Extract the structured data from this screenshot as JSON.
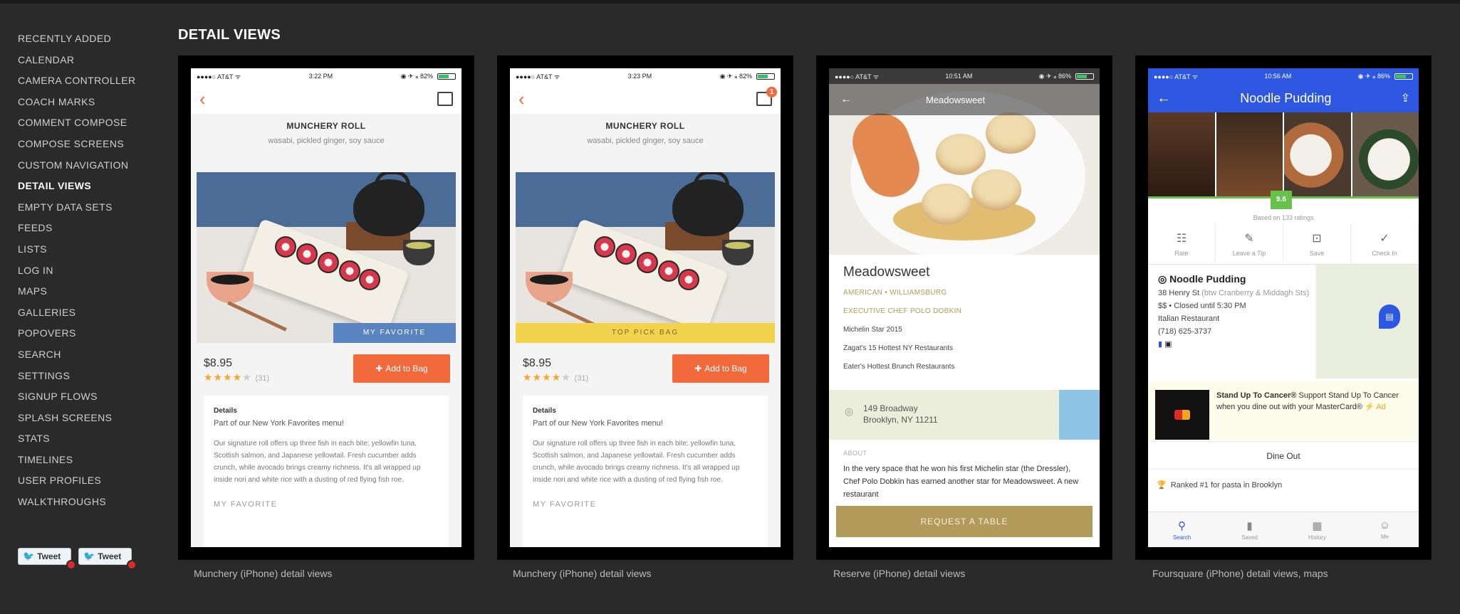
{
  "sidebar": {
    "items": [
      {
        "label": "RECENTLY ADDED",
        "active": false
      },
      {
        "label": "CALENDAR",
        "active": false
      },
      {
        "label": "CAMERA CONTROLLER",
        "active": false
      },
      {
        "label": "COACH MARKS",
        "active": false
      },
      {
        "label": "COMMENT COMPOSE",
        "active": false
      },
      {
        "label": "COMPOSE SCREENS",
        "active": false
      },
      {
        "label": "CUSTOM NAVIGATION",
        "active": false
      },
      {
        "label": "DETAIL VIEWS",
        "active": true
      },
      {
        "label": "EMPTY DATA SETS",
        "active": false
      },
      {
        "label": "FEEDS",
        "active": false
      },
      {
        "label": "LISTS",
        "active": false
      },
      {
        "label": "LOG IN",
        "active": false
      },
      {
        "label": "MAPS",
        "active": false
      },
      {
        "label": "GALLERIES",
        "active": false
      },
      {
        "label": "POPOVERS",
        "active": false
      },
      {
        "label": "SEARCH",
        "active": false
      },
      {
        "label": "SETTINGS",
        "active": false
      },
      {
        "label": "SIGNUP FLOWS",
        "active": false
      },
      {
        "label": "SPLASH SCREENS",
        "active": false
      },
      {
        "label": "STATS",
        "active": false
      },
      {
        "label": "TIMELINES",
        "active": false
      },
      {
        "label": "USER PROFILES",
        "active": false
      },
      {
        "label": "WALKTHROUGHS",
        "active": false
      }
    ],
    "tweet_buttons": [
      "Tweet",
      "Tweet"
    ]
  },
  "section_title": "DETAIL VIEWS",
  "captions": [
    "Munchery (iPhone) detail views",
    "Munchery (iPhone) detail views",
    "Reserve (iPhone) detail views",
    "Foursquare (iPhone) detail views, maps"
  ],
  "munchery1": {
    "status_left": "●●●●○ AT&T ᯤ",
    "status_time": "3:22 PM",
    "status_right": "◉ ✈ ⁎ 82%",
    "dish_title": "MUNCHERY ROLL",
    "dish_sub": "wasabi, pickled ginger, soy sauce",
    "ribbon": "MY FAVORITE",
    "price": "$8.95",
    "stars": "★★★★",
    "stars_empty": "★",
    "rating_count": "(31)",
    "add_button": "Add to Bag",
    "details_heading": "Details",
    "details_sub": "Part of our New York Favorites menu!",
    "details_body": "Our signature roll offers up three fish in each bite: yellowfin tuna, Scottish salmon, and Japanese yellowtail. Fresh cucumber adds crunch, while avocado brings creamy richness. It's all wrapped up inside nori and white rice with a dusting of red flying fish roe.",
    "details_fav": "MY FAVORITE"
  },
  "munchery2": {
    "status_left": "●●●●○ AT&T ᯤ",
    "status_time": "3:23 PM",
    "status_right": "◉ ✈ ⁎ 82%",
    "bag_count": "1",
    "dish_title": "MUNCHERY ROLL",
    "dish_sub": "wasabi, pickled ginger, soy sauce",
    "ribbon": "TOP PICK BAG",
    "price": "$8.95",
    "stars": "★★★★",
    "stars_empty": "★",
    "rating_count": "(31)",
    "add_button": "Add to Bag",
    "details_heading": "Details",
    "details_sub": "Part of our New York Favorites menu!",
    "details_body": "Our signature roll offers up three fish in each bite: yellowfin tuna, Scottish salmon, and Japanese yellowtail. Fresh cucumber adds crunch, while avocado brings creamy richness. It's all wrapped up inside nori and white rice with a dusting of red flying fish roe.",
    "details_fav": "MY FAVORITE"
  },
  "reserve": {
    "status_left": "●●●●○ AT&T ᯤ",
    "status_time": "10:51 AM",
    "status_right": "◉ ✈ ⁎ 86%",
    "nav_title": "Meadowsweet",
    "name": "Meadowsweet",
    "line1": "AMERICAN • WILLIAMSBURG",
    "line2": "EXECUTIVE CHEF POLO DOBKIN",
    "line3": "Michelin Star 2015",
    "line4": "Zagat's 15 Hottest NY Restaurants",
    "line5": "Eater's Hottest Brunch Restaurants",
    "addr1": "149 Broadway",
    "addr2": "Brooklyn, NY 11211",
    "about_label": "ABOUT",
    "about_body": "In the very space that he won his first Michelin star (the Dressler), Chef Polo Dobkin has earned another star for Meadowsweet. A new restaurant",
    "cta": "REQUEST A TABLE"
  },
  "foursquare": {
    "status_left": "●●●●○ AT&T ᯤ",
    "status_time": "10:56 AM",
    "status_right": "◉ ✈ ⁎ 86%",
    "title": "Noodle Pudding",
    "score": "9.6",
    "based_on": "Based on 133 ratings",
    "actions": [
      {
        "icon": "☷",
        "label": "Rate"
      },
      {
        "icon": "✎",
        "label": "Leave a Tip"
      },
      {
        "icon": "⊡",
        "label": "Save"
      },
      {
        "icon": "✓",
        "label": "Check In"
      }
    ],
    "venue_name": "Noodle Pudding",
    "address": "38 Henry St",
    "address_muted": "(btw Cranberry & Middagh Sts)",
    "hours": "$$ • Closed until 5:30 PM",
    "category": "Italian Restaurant",
    "phone": "(718) 625-3737",
    "ad_bold": "Stand Up To Cancer®",
    "ad_text": "Support Stand Up To Cancer when you dine out with your MasterCard®",
    "ad_label": "⚡ Ad",
    "dine_out": "Dine Out",
    "ranked": "Ranked #1 for pasta in Brooklyn",
    "tabs": [
      {
        "icon": "⚲",
        "label": "Search",
        "active": true
      },
      {
        "icon": "▮",
        "label": "Saved",
        "active": false
      },
      {
        "icon": "▦",
        "label": "History",
        "active": false
      },
      {
        "icon": "☺",
        "label": "Me",
        "active": false
      }
    ]
  }
}
